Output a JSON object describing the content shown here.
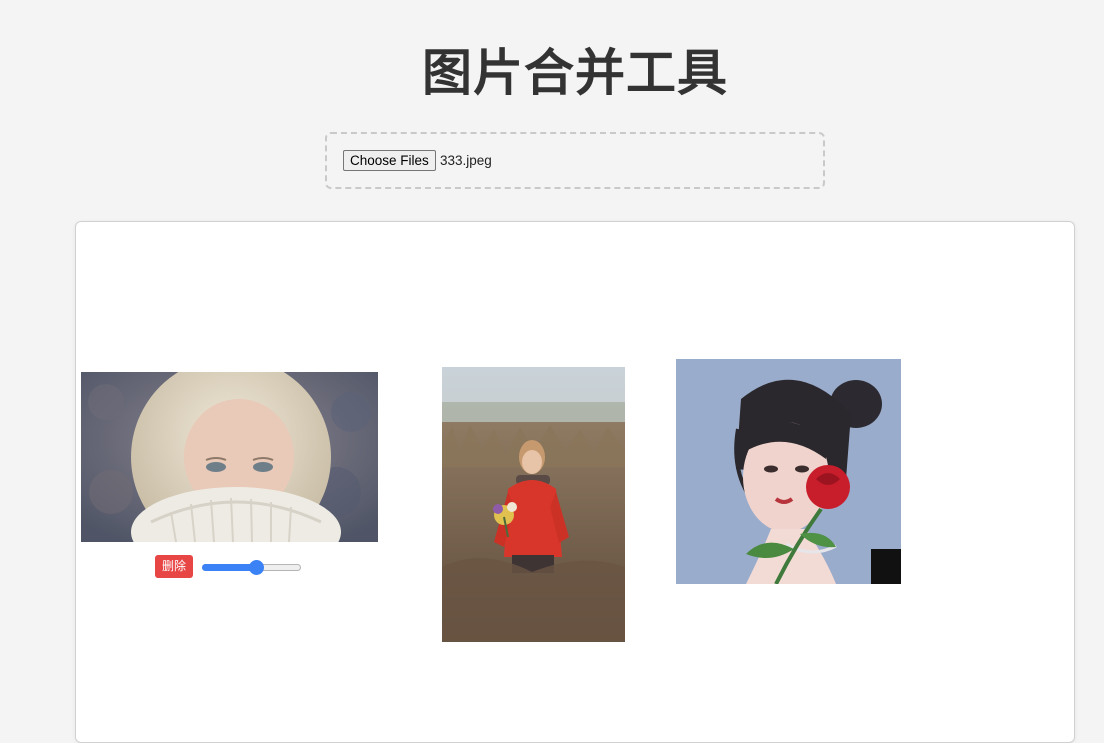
{
  "page": {
    "title": "图片合并工具"
  },
  "upload": {
    "button_label": "Choose Files",
    "file_name": "333.jpeg"
  },
  "images": [
    {
      "name": "image-white-hair-sweater",
      "controls": {
        "delete_label": "删除",
        "scale_value": 0.55
      }
    },
    {
      "name": "image-girl-red-sweater-field"
    },
    {
      "name": "image-woman-red-rose"
    }
  ],
  "colors": {
    "background": "#f4f4f4",
    "accent": "#3b82f6",
    "danger": "#e84545"
  }
}
